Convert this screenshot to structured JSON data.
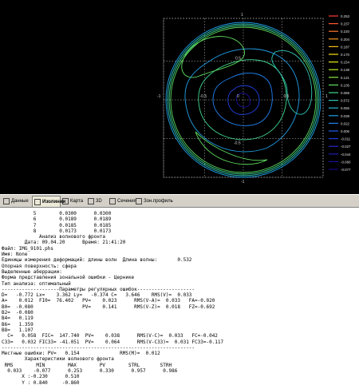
{
  "colorbar": {
    "labels": [
      "0.253",
      "0.237",
      "0.220",
      "0.204",
      "0.187",
      "0.170",
      "0.154",
      "0.138",
      "0.121",
      "0.105",
      "0.088",
      "0.072",
      "0.055",
      "0.039",
      "0.022",
      "0.006",
      "-0.011",
      "-0.027",
      "-0.044",
      "-0.060",
      "-0.077"
    ],
    "colors": [
      "#ff3b3b",
      "#ff5a30",
      "#ff7a28",
      "#ff9a20",
      "#ffbe18",
      "#ffe010",
      "#e8f010",
      "#c0f020",
      "#90e840",
      "#60e060",
      "#40d890",
      "#30c8b8",
      "#28b8d8",
      "#20a0e8",
      "#2080f0",
      "#2060f0",
      "#2040e0",
      "#2828d0",
      "#2018b8",
      "#1810a0",
      "#100888"
    ]
  },
  "axes": {
    "x_left": "-1",
    "x_right": "1",
    "x_mid_left": "-0.5",
    "x_mid_right": "0.5",
    "y_top": "1",
    "y_bottom": "-1",
    "y_mid_top": "0.5",
    "y_mid_bottom": "-0.5",
    "center": "0"
  },
  "tabs": [
    {
      "label": "Данные",
      "icon": "data-icon"
    },
    {
      "label": "Изолинии",
      "icon": "isolines-icon",
      "active": true
    },
    {
      "label": "Карта",
      "icon": "map-icon"
    },
    {
      "label": "3D",
      "icon": "3d-icon"
    },
    {
      "label": "Сечения",
      "icon": "sections-icon"
    },
    {
      "label": "Зон.профиль",
      "icon": "zone-profile-icon"
    }
  ],
  "report": {
    "top_rows": [
      "           5        0.0300      0.0300",
      "           6        0.0189      0.0189",
      "           7        0.0185      0.0185",
      "           8        0.0173      0.0173"
    ],
    "analysis_title": "             Анализ волнового фронта",
    "date_line": "        Дата: 09.04.20      Время: 21:41:20",
    "file_line": "Файл: IMG_9101.phs",
    "name_line": "Имя: None",
    "units_line": "Единицы измерения деформаций: длины волн  Длина волны:       0.532",
    "ref_line": "Опорная поверхность: сфера",
    "aberr_line": "Выделенные аберрации:",
    "form_line": "Форма представления зональной ошибки - Цернике",
    "type_line": "Тип анализа: оптимальный",
    "sep1": "--------------------Параметры регулярных ошибок--------------------",
    "param_rows": [
      "D=   -0.772 Lx=    3.362 Ly=   -0.374 C=   3.646    RMS(V)=  0.033",
      "A=    0.012  FI0=  76.402   PV=    0.023      RMS(V-A)=  0.033   FA=-0.020",
      "B0=  -0.080                 PV=    0.141      RMS(V-Z)=  0.018   FZ=-0.692",
      "B2=  -0.080",
      "B4=   0.119",
      "B6=   1.359",
      "B8=   1.107",
      "  C=   0.058  FIC=  147.740  PV=    0.038      RMS(V-C)=  0.033   FC=-0.042",
      "C33=   0.032 FIC33= -41.051  PV=    0.064      RMS(V-C33)=  0.031 FC33=-0.117"
    ],
    "sep2": "-------------------------------------------------------------------",
    "local_line": "Местные ошибки: PV=   0.154              RMS(M)=  0.012",
    "char_title": "        Характеристики волнового фронта",
    "char_header": " RMS        MIN        MAX        PV        STRL       STRH",
    "char_values": "  0.033    -0.077      0.253      0.330      0.957      0.986",
    "x_line": "       X :-0.230      0.510",
    "y_line": "       Y : 0.840     -0.860"
  }
}
